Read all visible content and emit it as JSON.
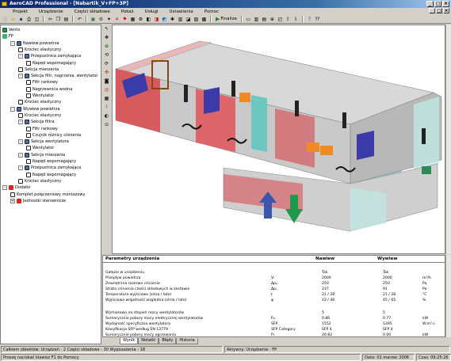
{
  "window": {
    "title": "AeroCAD Professional - [Nabartik_V+FP+3P]",
    "min": "_",
    "max": "□",
    "close": "×"
  },
  "menu": [
    "Projekt",
    "Urządzenie",
    "Części składowe",
    "Pokaż",
    "Usługi",
    "Ustawienia",
    "Pomoc"
  ],
  "toolbar": {
    "finalize_label": "Finalize"
  },
  "tree": [
    {
      "label": "Vento",
      "level": 0,
      "icon": "root"
    },
    {
      "label": "FP",
      "level": 0,
      "icon": "fp"
    },
    {
      "label": "Nawiew powietrza",
      "level": 1,
      "icon": "sec",
      "exp": "-"
    },
    {
      "label": "Krociec elastyczny",
      "level": 2,
      "icon": "elem"
    },
    {
      "label": "Przepustnica zamykająca",
      "level": 2,
      "icon": "sec",
      "exp": "-"
    },
    {
      "label": "Napęd wspomagający",
      "level": 3,
      "icon": "elem"
    },
    {
      "label": "Sekcja mieszania",
      "level": 2,
      "icon": "elem"
    },
    {
      "label": "Sekcja filtr, nagrzania, wentylator",
      "level": 2,
      "icon": "sec",
      "exp": "-"
    },
    {
      "label": "Filtr rankowy",
      "level": 3,
      "icon": "elem"
    },
    {
      "label": "Nagrzewnica wodna",
      "level": 3,
      "icon": "elem"
    },
    {
      "label": "Wentylator",
      "level": 3,
      "icon": "elem"
    },
    {
      "label": "Krociec elastyczny",
      "level": 2,
      "icon": "elem"
    },
    {
      "label": "Wywiew powietrza",
      "level": 1,
      "icon": "sec",
      "exp": "-"
    },
    {
      "label": "Krociec elastyczny",
      "level": 2,
      "icon": "elem"
    },
    {
      "label": "Sekcja filtra",
      "level": 2,
      "icon": "sec",
      "exp": "-"
    },
    {
      "label": "Filtr rankowy",
      "level": 3,
      "icon": "elem"
    },
    {
      "label": "Czujnik różnicy ciśnienia",
      "level": 3,
      "icon": "elem"
    },
    {
      "label": "Sekcja wentylatora",
      "level": 2,
      "icon": "sec",
      "exp": "-"
    },
    {
      "label": "Wentylator",
      "level": 3,
      "icon": "elem"
    },
    {
      "label": "Sekcja mieszania",
      "level": 2,
      "icon": "sec",
      "exp": "-"
    },
    {
      "label": "Napęd wspomagający",
      "level": 3,
      "icon": "elem"
    },
    {
      "label": "Przepustnica zamykająca",
      "level": 2,
      "icon": "sec",
      "exp": "-"
    },
    {
      "label": "Napęd wspomagający",
      "level": 3,
      "icon": "elem"
    },
    {
      "label": "Krociec elastyczny",
      "level": 2,
      "icon": "elem"
    },
    {
      "label": "Dodatki",
      "level": 0,
      "icon": "red",
      "exp": "-"
    },
    {
      "label": "Komplet połączeniowy montażowy",
      "level": 1,
      "icon": "elem"
    },
    {
      "label": "Jednostki sterownicze",
      "level": 1,
      "icon": "red",
      "exp": "+"
    }
  ],
  "params": {
    "header": {
      "title": "Parametry urządzenia",
      "col1": "Nawiew",
      "col2": "Wywiew"
    },
    "rows": [
      {
        "label": "Gałęzie w urządzeniu",
        "sym": "",
        "v1": "Tak",
        "v2": "Tak",
        "unit": ""
      },
      {
        "label": "Przepływ powietrza",
        "sym": "Vₗ",
        "v1": "2000",
        "v2": "2000",
        "unit": "m³/h"
      },
      {
        "label": "Zewnętrzna rezerwa ciśnienia",
        "sym": "Δpₑ",
        "v1": "250",
        "v2": "250",
        "unit": "Pa"
      },
      {
        "label": "Strata ciśnienia części składowych w zestawie",
        "sym": "Δpᵢ",
        "v1": "237",
        "v2": "91",
        "unit": "Pa"
      },
      {
        "label": "Temperatura wyjściowa (zima / lato)",
        "sym": "t",
        "v1": "21 / 28",
        "v2": "21 / 28",
        "unit": "°C"
      },
      {
        "label": "Wyjściowa wilgotność względna (zima / lato)",
        "sym": "φ",
        "v1": "12 / 46",
        "v2": "45 / 65",
        "unit": "%"
      },
      {
        "label": "Wymiarowo na stopień mocy wentylatorów",
        "sym": "",
        "v1": "5",
        "v2": "5",
        "unit": ""
      },
      {
        "label": "Sumarycznie pobory mocy elektrycznej wentylatorów",
        "sym": "Pₑₗ",
        "v1": "0.86",
        "v2": "0.77",
        "unit": "kW"
      },
      {
        "label": "Wydajność specyficzna wentylatora",
        "sym": "SFP",
        "v1": "1552",
        "v2": "1395",
        "unit": "W.m³.s"
      },
      {
        "label": "Klasyfikacja SFP według EN 13779",
        "sym": "SFP Category",
        "v1": "SFP 4",
        "v2": "SFP 4",
        "unit": ""
      },
      {
        "label": "Sumarycznie pobory mocy ogrzewania",
        "sym": "Pₒ",
        "v1": "20.82",
        "v2": "0.00",
        "unit": "kW"
      }
    ]
  },
  "tabs": [
    "Wynik",
    "Notatki",
    "Błędy",
    "Historia"
  ],
  "status": {
    "objects": "Całkiem obiektów: Urządzeń - 2   Części składowe - 30 Wyposażenia - 18",
    "active": "Aktywny: Urządzenie - FP",
    "hint": "Proszę naciskać klawisz F1 do Pomocy",
    "date": "Data: 01 marzec 2006",
    "time": "Czas: 09:25:26"
  },
  "colors": {
    "supply_red": "#d9474c",
    "teal": "#5fc8c0",
    "blue_panel": "#3a3aa8",
    "arrow_blue": "#3b56b0",
    "arrow_green": "#1f9a4a"
  }
}
